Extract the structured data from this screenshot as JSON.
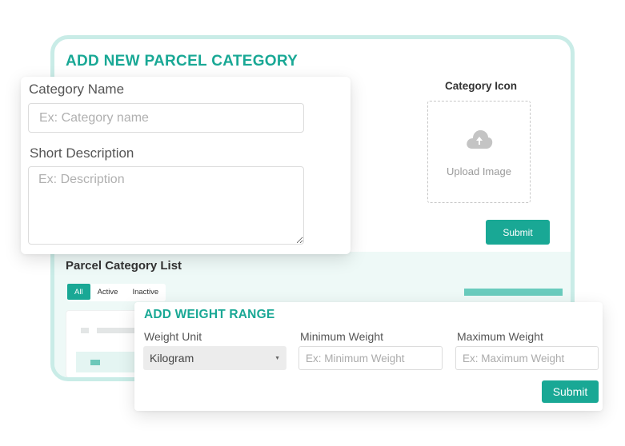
{
  "parcel_category": {
    "title": "ADD NEW PARCEL CATEGORY",
    "category_icon_label": "Category Icon",
    "upload_label": "Upload Image",
    "submit_label": "Submit"
  },
  "category_form": {
    "name_label": "Category Name",
    "name_placeholder": "Ex: Category name",
    "name_value": "",
    "description_label": "Short Description",
    "description_placeholder": "Ex: Description",
    "description_value": ""
  },
  "category_list": {
    "title": "Parcel Category List",
    "tabs": [
      {
        "label": "All",
        "active": true
      },
      {
        "label": "Active",
        "active": false
      },
      {
        "label": "Inactive",
        "active": false
      }
    ]
  },
  "weight_range": {
    "title": "ADD WEIGHT RANGE",
    "unit_label": "Weight Unit",
    "unit_selected": "Kilogram",
    "min_label": "Minimum Weight",
    "min_placeholder": "Ex: Minimum Weight",
    "max_label": "Maximum Weight",
    "max_placeholder": "Ex: Maximum Weight",
    "submit_label": "Submit"
  },
  "colors": {
    "accent": "#19a895",
    "accent_light": "#c9ece7",
    "band": "#eef9f7"
  },
  "icons": {
    "upload": "cloud-upload-icon",
    "select_caret": "caret-down-icon"
  }
}
